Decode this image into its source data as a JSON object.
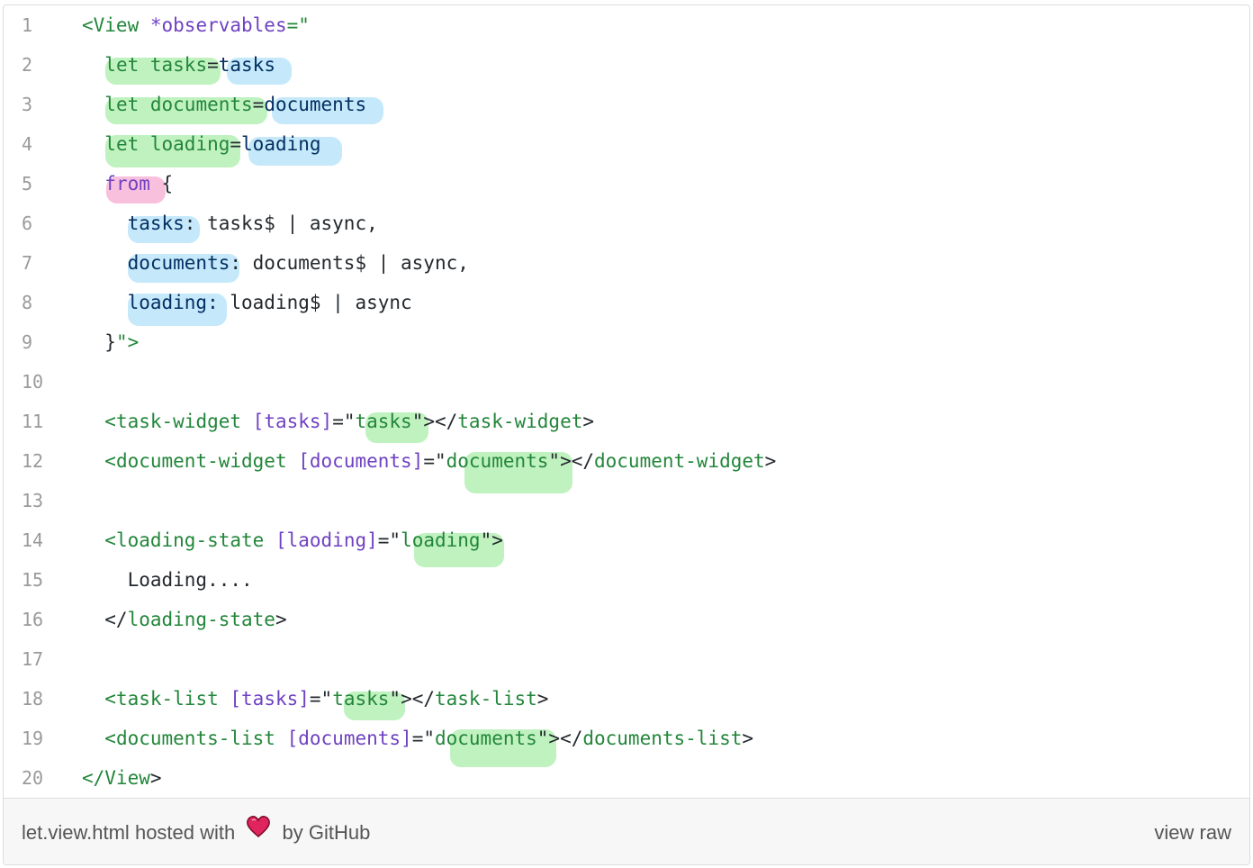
{
  "code": {
    "lines": [
      {
        "n": "1",
        "segments": [
          {
            "t": "tag",
            "v": "<View"
          },
          {
            "t": "txt",
            "v": " "
          },
          {
            "t": "attr",
            "v": "*observables"
          },
          {
            "t": "tag",
            "v": "=\""
          }
        ]
      },
      {
        "n": "2",
        "segments": [
          {
            "t": "txt",
            "v": "  "
          },
          {
            "t": "tag",
            "v": "let tasks"
          },
          {
            "t": "txt",
            "v": "="
          },
          {
            "t": "str",
            "v": "tasks"
          }
        ]
      },
      {
        "n": "3",
        "segments": [
          {
            "t": "txt",
            "v": "  "
          },
          {
            "t": "tag",
            "v": "let documents"
          },
          {
            "t": "txt",
            "v": "="
          },
          {
            "t": "str",
            "v": "documents"
          }
        ]
      },
      {
        "n": "4",
        "segments": [
          {
            "t": "txt",
            "v": "  "
          },
          {
            "t": "tag",
            "v": "let loading"
          },
          {
            "t": "txt",
            "v": "="
          },
          {
            "t": "str",
            "v": "loading"
          }
        ]
      },
      {
        "n": "5",
        "segments": [
          {
            "t": "txt",
            "v": "  "
          },
          {
            "t": "attr",
            "v": "from"
          },
          {
            "t": "txt",
            "v": " {"
          }
        ]
      },
      {
        "n": "6",
        "segments": [
          {
            "t": "txt",
            "v": "    "
          },
          {
            "t": "str",
            "v": "tasks"
          },
          {
            "t": "txt",
            "v": ": tasks$ | async,"
          }
        ]
      },
      {
        "n": "7",
        "segments": [
          {
            "t": "txt",
            "v": "    "
          },
          {
            "t": "str",
            "v": "documents"
          },
          {
            "t": "txt",
            "v": ": documents$ | async,"
          }
        ]
      },
      {
        "n": "8",
        "segments": [
          {
            "t": "txt",
            "v": "    "
          },
          {
            "t": "str",
            "v": "loading:"
          },
          {
            "t": "txt",
            "v": " loading$ | async"
          }
        ]
      },
      {
        "n": "9",
        "segments": [
          {
            "t": "txt",
            "v": "  }"
          },
          {
            "t": "tag",
            "v": "\">"
          }
        ]
      },
      {
        "n": "10",
        "segments": []
      },
      {
        "n": "11",
        "segments": [
          {
            "t": "txt",
            "v": "  "
          },
          {
            "t": "tag",
            "v": "<task-widget"
          },
          {
            "t": "txt",
            "v": " "
          },
          {
            "t": "attr",
            "v": "[tasks]"
          },
          {
            "t": "txt",
            "v": "=\""
          },
          {
            "t": "tag",
            "v": "tasks"
          },
          {
            "t": "txt",
            "v": "\"></"
          },
          {
            "t": "tag",
            "v": "task-widget"
          },
          {
            "t": "txt",
            "v": ">"
          }
        ]
      },
      {
        "n": "12",
        "segments": [
          {
            "t": "txt",
            "v": "  "
          },
          {
            "t": "tag",
            "v": "<document-widget"
          },
          {
            "t": "txt",
            "v": " "
          },
          {
            "t": "attr",
            "v": "[documents]"
          },
          {
            "t": "txt",
            "v": "=\""
          },
          {
            "t": "tag",
            "v": "documents"
          },
          {
            "t": "txt",
            "v": "\"></"
          },
          {
            "t": "tag",
            "v": "document-widget"
          },
          {
            "t": "txt",
            "v": ">"
          }
        ]
      },
      {
        "n": "13",
        "segments": []
      },
      {
        "n": "14",
        "segments": [
          {
            "t": "txt",
            "v": "  "
          },
          {
            "t": "tag",
            "v": "<loading-state"
          },
          {
            "t": "txt",
            "v": " "
          },
          {
            "t": "attr",
            "v": "[laoding]"
          },
          {
            "t": "txt",
            "v": "=\""
          },
          {
            "t": "tag",
            "v": "loading"
          },
          {
            "t": "txt",
            "v": "\">"
          }
        ]
      },
      {
        "n": "15",
        "segments": [
          {
            "t": "txt",
            "v": "    Loading...."
          }
        ]
      },
      {
        "n": "16",
        "segments": [
          {
            "t": "txt",
            "v": "  </"
          },
          {
            "t": "tag",
            "v": "loading-state"
          },
          {
            "t": "txt",
            "v": ">"
          }
        ]
      },
      {
        "n": "17",
        "segments": []
      },
      {
        "n": "18",
        "segments": [
          {
            "t": "txt",
            "v": "  "
          },
          {
            "t": "tag",
            "v": "<task-list"
          },
          {
            "t": "txt",
            "v": " "
          },
          {
            "t": "attr",
            "v": "[tasks]"
          },
          {
            "t": "txt",
            "v": "=\""
          },
          {
            "t": "tag",
            "v": "tasks"
          },
          {
            "t": "txt",
            "v": "\"></"
          },
          {
            "t": "tag",
            "v": "task-list"
          },
          {
            "t": "txt",
            "v": ">"
          }
        ]
      },
      {
        "n": "19",
        "segments": [
          {
            "t": "txt",
            "v": "  "
          },
          {
            "t": "tag",
            "v": "<documents-list"
          },
          {
            "t": "txt",
            "v": " "
          },
          {
            "t": "attr",
            "v": "[documents]"
          },
          {
            "t": "txt",
            "v": "=\""
          },
          {
            "t": "tag",
            "v": "documents"
          },
          {
            "t": "txt",
            "v": "\"></"
          },
          {
            "t": "tag",
            "v": "documents-list"
          },
          {
            "t": "txt",
            "v": ">"
          }
        ]
      },
      {
        "n": "20",
        "segments": [
          {
            "t": "tag",
            "v": "</View"
          },
          {
            "t": "txt",
            "v": ">"
          }
        ]
      }
    ]
  },
  "footer": {
    "filename": "let.view.html",
    "hosted_with": "hosted with",
    "by": "by",
    "provider": "GitHub",
    "view_raw": "view raw"
  },
  "colors": {
    "tag": "#22863a",
    "attr": "#6f42c1",
    "string": "#032f62",
    "heart": "#e0245e"
  },
  "icons": {
    "heart": "heart-icon"
  }
}
